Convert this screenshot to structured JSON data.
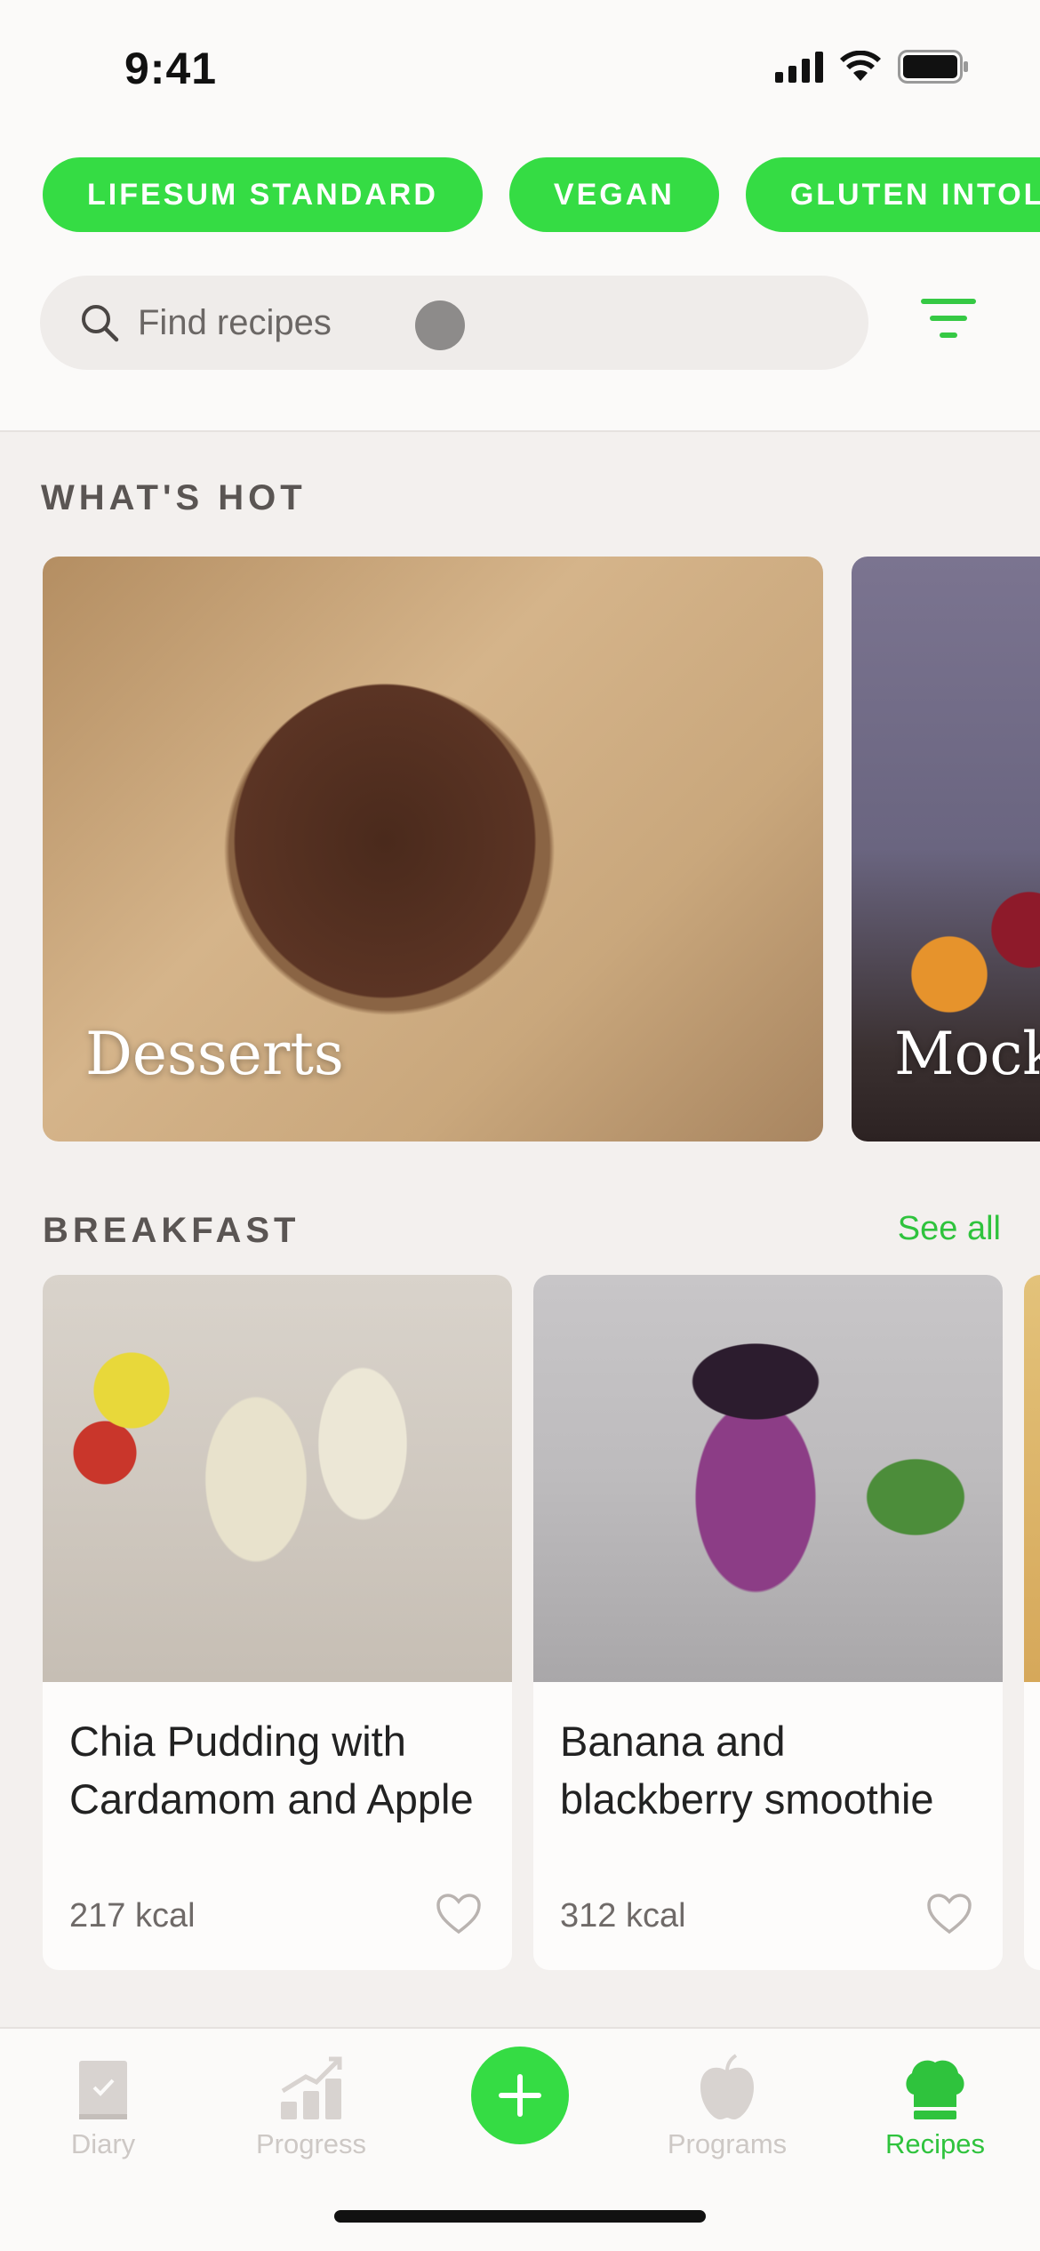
{
  "status_bar": {
    "time": "9:41"
  },
  "diet_chips": [
    {
      "label": "LIFESUM STANDARD"
    },
    {
      "label": "VEGAN"
    },
    {
      "label": "GLUTEN INTOLERANT"
    }
  ],
  "search": {
    "placeholder": "Find recipes",
    "icon": "search-icon"
  },
  "filter": {
    "icon": "filter-icon",
    "color": "#35c944"
  },
  "whats_hot": {
    "title": "WHAT'S HOT",
    "cards": [
      {
        "label": "Desserts"
      },
      {
        "label": "Mocktails"
      }
    ]
  },
  "breakfast": {
    "title": "BREAKFAST",
    "see_all": "See all",
    "cards": [
      {
        "title": "Chia Pudding with Cardamom and Apple",
        "kcal": "217 kcal",
        "favorite": false
      },
      {
        "title": "Banana and blackberry smoothie",
        "kcal": "312 kcal",
        "favorite": false
      }
    ]
  },
  "tabbar": {
    "items": [
      {
        "label": "Diary",
        "icon": "book-icon",
        "active": false
      },
      {
        "label": "Progress",
        "icon": "chart-icon",
        "active": false
      },
      {
        "label": "Programs",
        "icon": "apple-icon",
        "active": false
      },
      {
        "label": "Recipes",
        "icon": "chef-hat-icon",
        "active": true
      }
    ],
    "add_icon": "plus-icon"
  },
  "colors": {
    "brand_green": "#35dc44",
    "active_tab": "#2fc33d",
    "inactive_tab": "#cdc8c5"
  }
}
